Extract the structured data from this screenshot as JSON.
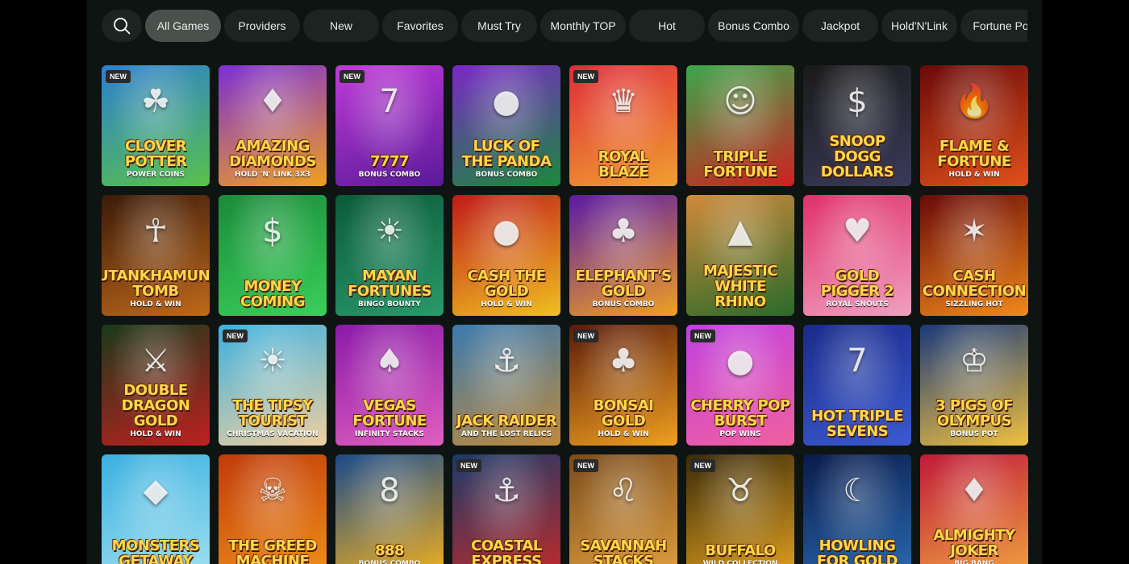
{
  "filters": {
    "search_icon": "search-icon",
    "chips": [
      {
        "label": "All Games",
        "active": true
      },
      {
        "label": "Providers",
        "active": false
      },
      {
        "label": "New",
        "active": false
      },
      {
        "label": "Favorites",
        "active": false
      },
      {
        "label": "Must Try",
        "active": false
      },
      {
        "label": "Monthly TOP",
        "active": false
      },
      {
        "label": "Hot",
        "active": false
      },
      {
        "label": "Bonus Combo",
        "active": false
      },
      {
        "label": "Jackpot",
        "active": false
      },
      {
        "label": "Hold'N'Link",
        "active": false
      },
      {
        "label": "Fortune Po",
        "active": false
      }
    ]
  },
  "badge_label": "NEW",
  "games": [
    {
      "title": "Clover Potter",
      "subtitle": "Power Coins",
      "is_new": true,
      "colors": [
        "#2b7fd0",
        "#5ac14a"
      ],
      "emblem": "☘"
    },
    {
      "title": "Amazing Diamonds",
      "subtitle": "Hold 'N' Link 3x3",
      "is_new": false,
      "colors": [
        "#7b2ed6",
        "#f0a020"
      ],
      "emblem": "♦"
    },
    {
      "title": "7777",
      "subtitle": "Bonus Combo",
      "is_new": true,
      "colors": [
        "#c03ad8",
        "#5a1a9a"
      ],
      "emblem": "7"
    },
    {
      "title": "Luck of the Panda",
      "subtitle": "Bonus Combo",
      "is_new": false,
      "colors": [
        "#7a28c8",
        "#1a8a3a"
      ],
      "emblem": "●"
    },
    {
      "title": "Royal Blaze",
      "subtitle": "",
      "is_new": true,
      "colors": [
        "#e02a3a",
        "#f0a030"
      ],
      "emblem": "♛"
    },
    {
      "title": "Triple Fortune",
      "subtitle": "",
      "is_new": false,
      "colors": [
        "#3aa84a",
        "#d02020"
      ],
      "emblem": "☺"
    },
    {
      "title": "Snoop Dogg Dollars",
      "subtitle": "",
      "is_new": false,
      "colors": [
        "#1a1a1a",
        "#3a3a5a"
      ],
      "emblem": "$"
    },
    {
      "title": "Flame & Fortune",
      "subtitle": "Hold & Win",
      "is_new": false,
      "colors": [
        "#6a0a0a",
        "#e0501a"
      ],
      "emblem": "🔥"
    },
    {
      "title": "Tutankhamun's Tomb",
      "subtitle": "Hold & Win",
      "is_new": false,
      "colors": [
        "#3a1a0a",
        "#c06a1a"
      ],
      "emblem": "☥"
    },
    {
      "title": "Money Coming",
      "subtitle": "",
      "is_new": false,
      "colors": [
        "#1a8a3a",
        "#3ad05a"
      ],
      "emblem": "$"
    },
    {
      "title": "Mayan Fortunes",
      "subtitle": "Bingo Bounty",
      "is_new": false,
      "colors": [
        "#0a5a3a",
        "#2a9a6a"
      ],
      "emblem": "☀"
    },
    {
      "title": "Cash the Gold",
      "subtitle": "Hold & Win",
      "is_new": false,
      "colors": [
        "#c01a1a",
        "#f0c020"
      ],
      "emblem": "●"
    },
    {
      "title": "Elephant's Gold",
      "subtitle": "Bonus Combo",
      "is_new": false,
      "colors": [
        "#5a1aa8",
        "#f0a020"
      ],
      "emblem": "♣"
    },
    {
      "title": "Majestic White Rhino",
      "subtitle": "",
      "is_new": false,
      "colors": [
        "#d08a3a",
        "#2a6a2a"
      ],
      "emblem": "▲"
    },
    {
      "title": "Gold Pigger 2",
      "subtitle": "Royal Snouts",
      "is_new": false,
      "colors": [
        "#e0306a",
        "#f0a0c0"
      ],
      "emblem": "♥"
    },
    {
      "title": "Cash Connection",
      "subtitle": "Sizzling Hot",
      "is_new": false,
      "colors": [
        "#6a0a0a",
        "#f08a1a"
      ],
      "emblem": "✶"
    },
    {
      "title": "Double Dragon Gold",
      "subtitle": "Hold & Win",
      "is_new": false,
      "colors": [
        "#1a3a1a",
        "#c02020"
      ],
      "emblem": "⚔"
    },
    {
      "title": "The Tipsy Tourist",
      "subtitle": "Christmas Vacation",
      "is_new": true,
      "colors": [
        "#3ab0e0",
        "#f0d0a0"
      ],
      "emblem": "☀"
    },
    {
      "title": "Vegas Fortune",
      "subtitle": "Infinity Stacks",
      "is_new": false,
      "colors": [
        "#8a1aa8",
        "#e060c0"
      ],
      "emblem": "♠"
    },
    {
      "title": "Jack Raider",
      "subtitle": "and the Lost Relics",
      "is_new": false,
      "colors": [
        "#3a7ab0",
        "#c08a3a"
      ],
      "emblem": "⚓"
    },
    {
      "title": "Bonsai Gold",
      "subtitle": "Hold & Win",
      "is_new": true,
      "colors": [
        "#5a1a0a",
        "#f0a020"
      ],
      "emblem": "♣"
    },
    {
      "title": "Cherry Pop Burst",
      "subtitle": "Pop Wins",
      "is_new": true,
      "colors": [
        "#c040e0",
        "#f060a0"
      ],
      "emblem": "●"
    },
    {
      "title": "Hot Triple Sevens",
      "subtitle": "",
      "is_new": false,
      "colors": [
        "#1a2a8a",
        "#3a5ad0"
      ],
      "emblem": "7"
    },
    {
      "title": "3 Pigs of Olympus",
      "subtitle": "Bonus Pot",
      "is_new": false,
      "colors": [
        "#1a3a7a",
        "#f0c040"
      ],
      "emblem": "♔"
    },
    {
      "title": "Monsters Getaway",
      "subtitle": "",
      "is_new": false,
      "colors": [
        "#3ab0e0",
        "#a0e0f0"
      ],
      "emblem": "◆"
    },
    {
      "title": "The Greed Machine",
      "subtitle": "",
      "is_new": false,
      "colors": [
        "#c03a0a",
        "#f0901a"
      ],
      "emblem": "☠"
    },
    {
      "title": "888",
      "subtitle": "Bonus Combo",
      "is_new": false,
      "colors": [
        "#1a4a8a",
        "#f0b020"
      ],
      "emblem": "8"
    },
    {
      "title": "Coastal Express",
      "subtitle": "",
      "is_new": true,
      "colors": [
        "#1a3a6a",
        "#c02a2a"
      ],
      "emblem": "⚓"
    },
    {
      "title": "Savannah Stacks",
      "subtitle": "",
      "is_new": true,
      "colors": [
        "#7a4a1a",
        "#e0a040"
      ],
      "emblem": "♌"
    },
    {
      "title": "Buffalo",
      "subtitle": "Wild Collection",
      "is_new": true,
      "colors": [
        "#3a2a0a",
        "#e0a020"
      ],
      "emblem": "♉"
    },
    {
      "title": "Howling for Gold",
      "subtitle": "",
      "is_new": false,
      "colors": [
        "#0a1a4a",
        "#2a6ab0"
      ],
      "emblem": "☾"
    },
    {
      "title": "Almighty Joker",
      "subtitle": "Big Bang",
      "is_new": false,
      "colors": [
        "#c01a3a",
        "#f0a040"
      ],
      "emblem": "♦"
    }
  ]
}
